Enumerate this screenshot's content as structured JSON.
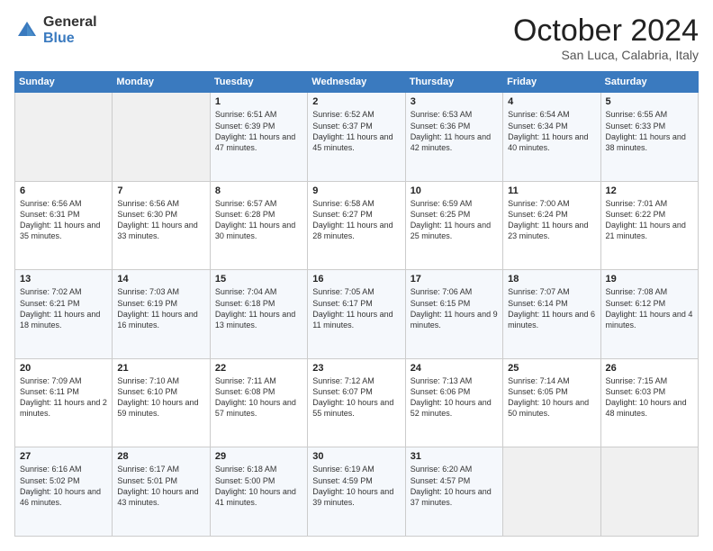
{
  "logo": {
    "general": "General",
    "blue": "Blue"
  },
  "header": {
    "month": "October 2024",
    "location": "San Luca, Calabria, Italy"
  },
  "days": [
    "Sunday",
    "Monday",
    "Tuesday",
    "Wednesday",
    "Thursday",
    "Friday",
    "Saturday"
  ],
  "weeks": [
    [
      {
        "day": "",
        "content": ""
      },
      {
        "day": "",
        "content": ""
      },
      {
        "day": "1",
        "content": "Sunrise: 6:51 AM\nSunset: 6:39 PM\nDaylight: 11 hours and 47 minutes."
      },
      {
        "day": "2",
        "content": "Sunrise: 6:52 AM\nSunset: 6:37 PM\nDaylight: 11 hours and 45 minutes."
      },
      {
        "day": "3",
        "content": "Sunrise: 6:53 AM\nSunset: 6:36 PM\nDaylight: 11 hours and 42 minutes."
      },
      {
        "day": "4",
        "content": "Sunrise: 6:54 AM\nSunset: 6:34 PM\nDaylight: 11 hours and 40 minutes."
      },
      {
        "day": "5",
        "content": "Sunrise: 6:55 AM\nSunset: 6:33 PM\nDaylight: 11 hours and 38 minutes."
      }
    ],
    [
      {
        "day": "6",
        "content": "Sunrise: 6:56 AM\nSunset: 6:31 PM\nDaylight: 11 hours and 35 minutes."
      },
      {
        "day": "7",
        "content": "Sunrise: 6:56 AM\nSunset: 6:30 PM\nDaylight: 11 hours and 33 minutes."
      },
      {
        "day": "8",
        "content": "Sunrise: 6:57 AM\nSunset: 6:28 PM\nDaylight: 11 hours and 30 minutes."
      },
      {
        "day": "9",
        "content": "Sunrise: 6:58 AM\nSunset: 6:27 PM\nDaylight: 11 hours and 28 minutes."
      },
      {
        "day": "10",
        "content": "Sunrise: 6:59 AM\nSunset: 6:25 PM\nDaylight: 11 hours and 25 minutes."
      },
      {
        "day": "11",
        "content": "Sunrise: 7:00 AM\nSunset: 6:24 PM\nDaylight: 11 hours and 23 minutes."
      },
      {
        "day": "12",
        "content": "Sunrise: 7:01 AM\nSunset: 6:22 PM\nDaylight: 11 hours and 21 minutes."
      }
    ],
    [
      {
        "day": "13",
        "content": "Sunrise: 7:02 AM\nSunset: 6:21 PM\nDaylight: 11 hours and 18 minutes."
      },
      {
        "day": "14",
        "content": "Sunrise: 7:03 AM\nSunset: 6:19 PM\nDaylight: 11 hours and 16 minutes."
      },
      {
        "day": "15",
        "content": "Sunrise: 7:04 AM\nSunset: 6:18 PM\nDaylight: 11 hours and 13 minutes."
      },
      {
        "day": "16",
        "content": "Sunrise: 7:05 AM\nSunset: 6:17 PM\nDaylight: 11 hours and 11 minutes."
      },
      {
        "day": "17",
        "content": "Sunrise: 7:06 AM\nSunset: 6:15 PM\nDaylight: 11 hours and 9 minutes."
      },
      {
        "day": "18",
        "content": "Sunrise: 7:07 AM\nSunset: 6:14 PM\nDaylight: 11 hours and 6 minutes."
      },
      {
        "day": "19",
        "content": "Sunrise: 7:08 AM\nSunset: 6:12 PM\nDaylight: 11 hours and 4 minutes."
      }
    ],
    [
      {
        "day": "20",
        "content": "Sunrise: 7:09 AM\nSunset: 6:11 PM\nDaylight: 11 hours and 2 minutes."
      },
      {
        "day": "21",
        "content": "Sunrise: 7:10 AM\nSunset: 6:10 PM\nDaylight: 10 hours and 59 minutes."
      },
      {
        "day": "22",
        "content": "Sunrise: 7:11 AM\nSunset: 6:08 PM\nDaylight: 10 hours and 57 minutes."
      },
      {
        "day": "23",
        "content": "Sunrise: 7:12 AM\nSunset: 6:07 PM\nDaylight: 10 hours and 55 minutes."
      },
      {
        "day": "24",
        "content": "Sunrise: 7:13 AM\nSunset: 6:06 PM\nDaylight: 10 hours and 52 minutes."
      },
      {
        "day": "25",
        "content": "Sunrise: 7:14 AM\nSunset: 6:05 PM\nDaylight: 10 hours and 50 minutes."
      },
      {
        "day": "26",
        "content": "Sunrise: 7:15 AM\nSunset: 6:03 PM\nDaylight: 10 hours and 48 minutes."
      }
    ],
    [
      {
        "day": "27",
        "content": "Sunrise: 6:16 AM\nSunset: 5:02 PM\nDaylight: 10 hours and 46 minutes."
      },
      {
        "day": "28",
        "content": "Sunrise: 6:17 AM\nSunset: 5:01 PM\nDaylight: 10 hours and 43 minutes."
      },
      {
        "day": "29",
        "content": "Sunrise: 6:18 AM\nSunset: 5:00 PM\nDaylight: 10 hours and 41 minutes."
      },
      {
        "day": "30",
        "content": "Sunrise: 6:19 AM\nSunset: 4:59 PM\nDaylight: 10 hours and 39 minutes."
      },
      {
        "day": "31",
        "content": "Sunrise: 6:20 AM\nSunset: 4:57 PM\nDaylight: 10 hours and 37 minutes."
      },
      {
        "day": "",
        "content": ""
      },
      {
        "day": "",
        "content": ""
      }
    ]
  ]
}
